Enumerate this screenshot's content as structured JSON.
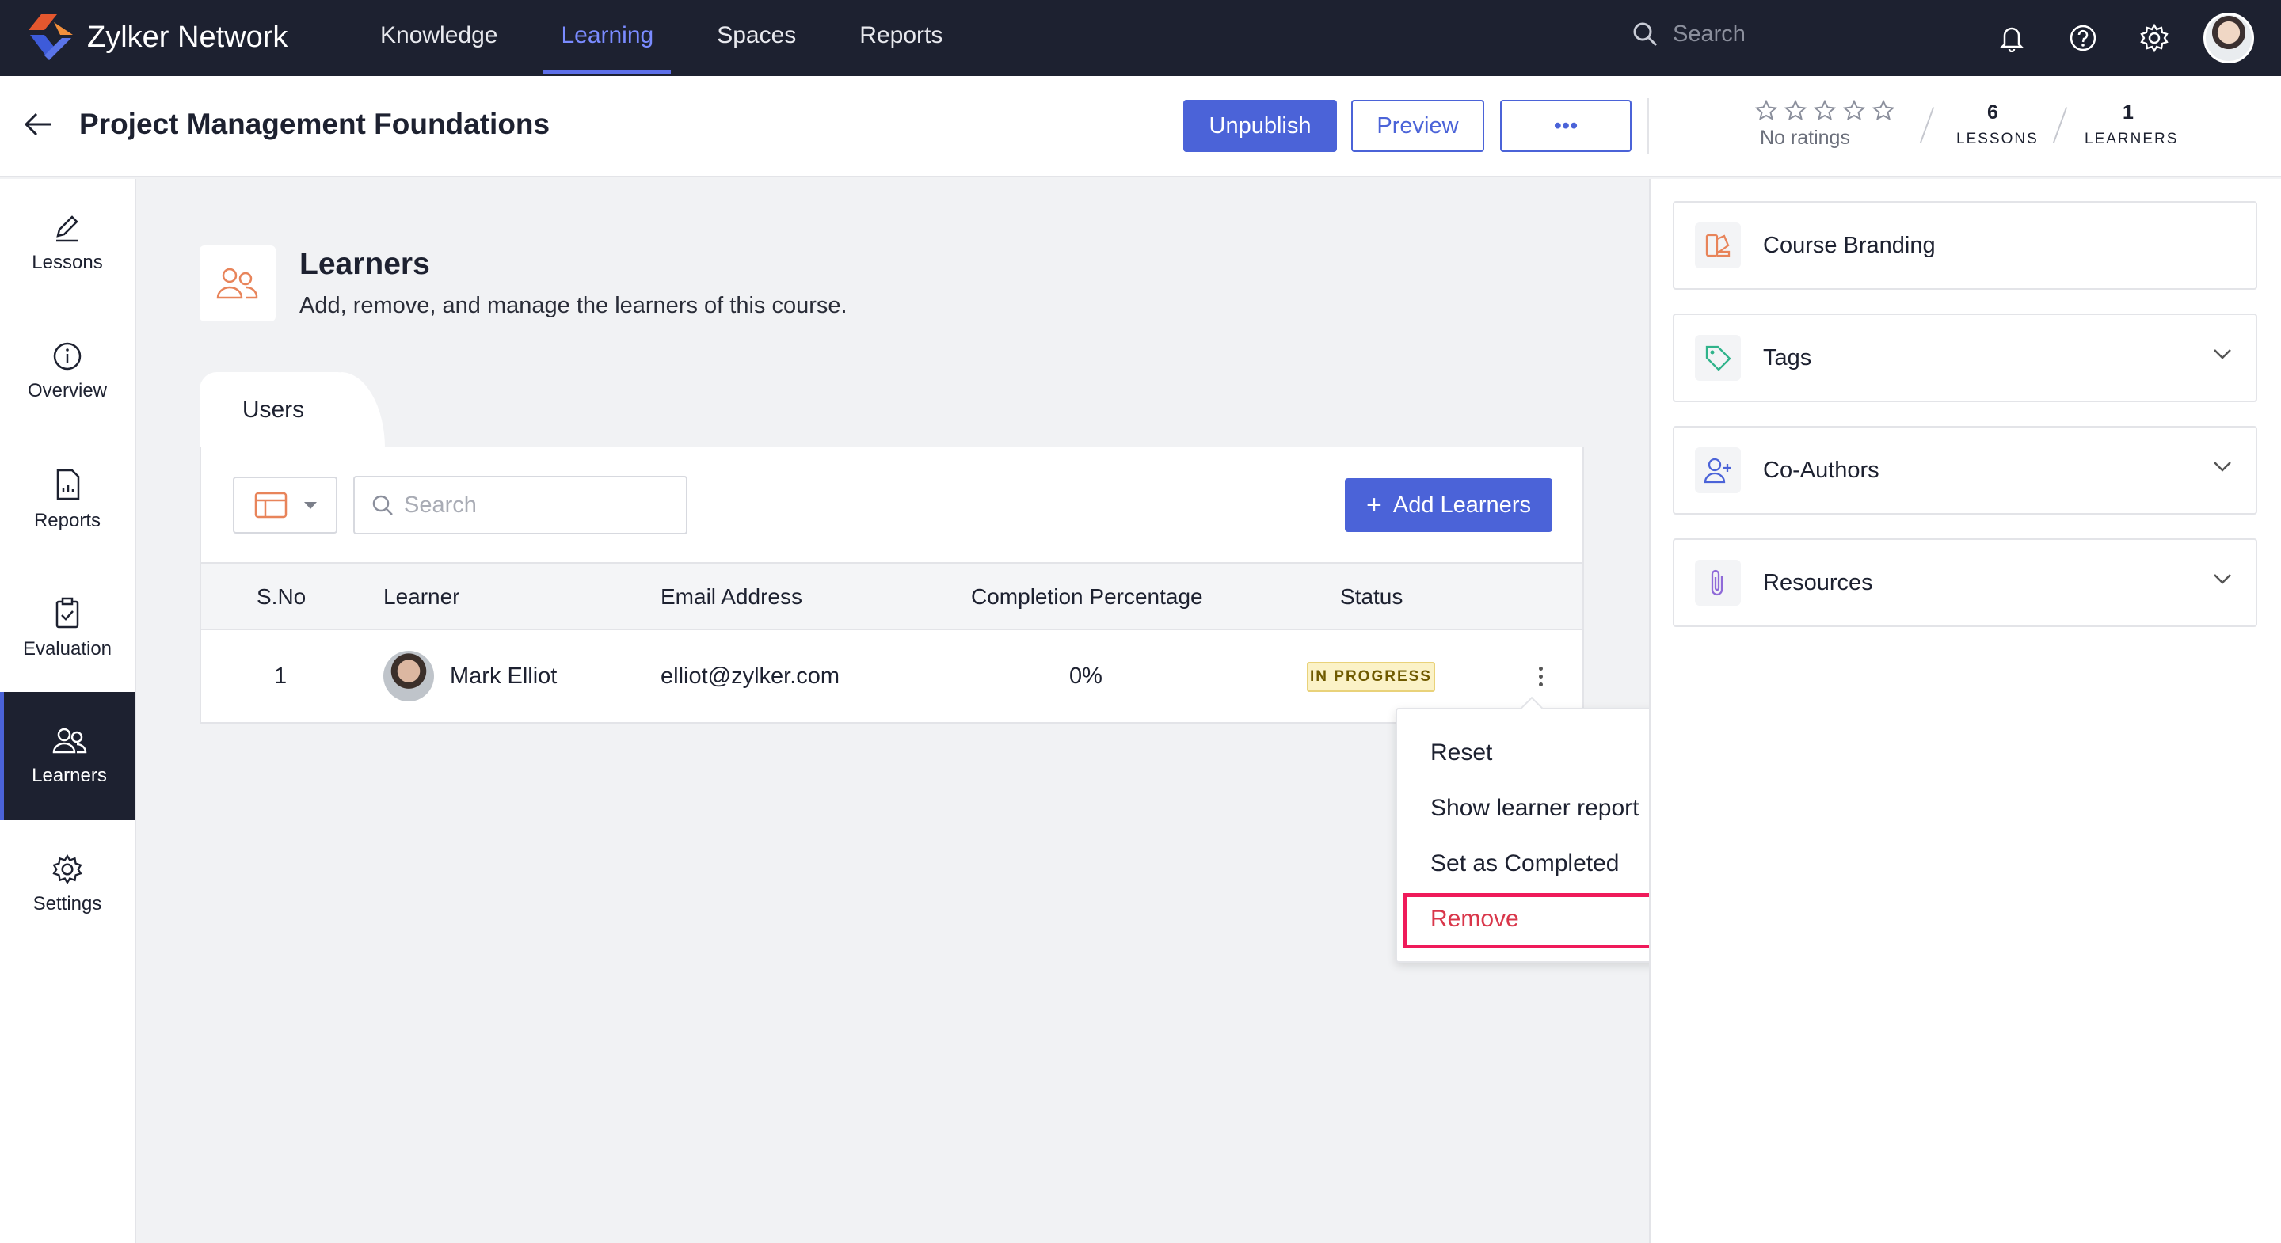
{
  "app": {
    "brand": "Zylker Network",
    "nav": [
      "Knowledge",
      "Learning",
      "Spaces",
      "Reports"
    ],
    "active_nav": "Learning",
    "search_placeholder": "Search"
  },
  "header": {
    "title": "Project Management Foundations",
    "unpublish": "Unpublish",
    "preview": "Preview",
    "more": "•••",
    "ratings": "No ratings",
    "lessons_count": "6",
    "lessons_label": "LESSONS",
    "learners_count": "1",
    "learners_label": "LEARNERS"
  },
  "sidebar": {
    "items": [
      "Lessons",
      "Overview",
      "Reports",
      "Evaluation",
      "Learners",
      "Settings"
    ],
    "active": "Learners"
  },
  "section": {
    "title": "Learners",
    "description": "Add, remove, and manage the learners of this course."
  },
  "tabs": {
    "users": "Users"
  },
  "toolbar": {
    "search_placeholder": "Search",
    "add_button": "Add Learners"
  },
  "table": {
    "columns": [
      "S.No",
      "Learner",
      "Email Address",
      "Completion Percentage",
      "Status"
    ],
    "rows": [
      {
        "sno": "1",
        "learner": "Mark Elliot",
        "email": "elliot@zylker.com",
        "completion": "0%",
        "status": "IN PROGRESS"
      }
    ]
  },
  "menu": {
    "items": [
      "Reset",
      "Show learner report",
      "Set as Completed",
      "Remove"
    ]
  },
  "right": {
    "cards": [
      "Course Branding",
      "Tags",
      "Co-Authors",
      "Resources"
    ]
  },
  "colors": {
    "nav_bg": "#1d2130",
    "accent": "#4b63d8",
    "highlight": "#ef1a5a",
    "remove_text": "#d9364a"
  }
}
